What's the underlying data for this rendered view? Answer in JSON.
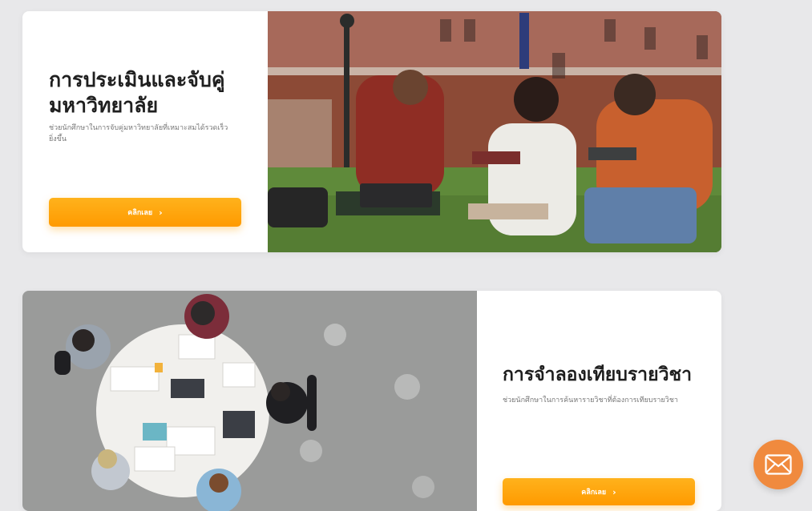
{
  "cards": [
    {
      "title": "การประเมินและจับคู่มหาวิทยาลัย",
      "subtitle": "ช่วยนักศึกษาในการจับคู่มหาวิทยาลัยที่เหมาะสมได้รวดเร็วยิ่งขึ้น",
      "button_label": "คลิกเลย",
      "button_icon": "chevron-right-icon"
    },
    {
      "title": "การจำลองเทียบรายวิชา",
      "subtitle": "ช่วยนักศึกษาในการค้นหารายวิชาที่ต้องการเทียบรายวิชา",
      "button_label": "คลิกเลย",
      "button_icon": "chevron-right-icon"
    }
  ],
  "fab": {
    "icon": "mail-icon",
    "color": "#f08a3e"
  },
  "colors": {
    "accent": "#ff9f00",
    "background": "#e8e8ea",
    "title": "#1f1f1f"
  }
}
